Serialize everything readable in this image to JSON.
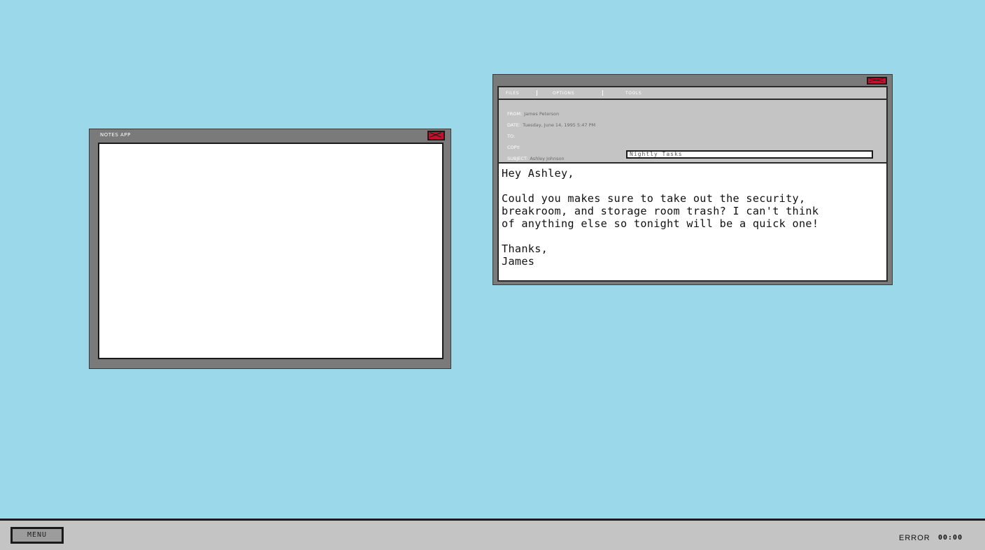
{
  "notes_app": {
    "title": "NOTES APP",
    "close_icon": "close-x-icon"
  },
  "email_app": {
    "close_icon": "close-x-icon",
    "menu": [
      {
        "label": "FILES"
      },
      {
        "label": "OPTIONS"
      },
      {
        "label": "TOOLS"
      }
    ],
    "from_label": "FROM:",
    "from_value": "James Peterson",
    "date_label": "DATE:",
    "date_value": "Tuesday, June 14, 1995 5:47 PM",
    "to_label": "TO:",
    "copy_label": "COPY:",
    "subject_label": "SUBJECT:",
    "subject_recipient": "Ashley Johnson",
    "subject_value": "Nightly Tasks",
    "body_lines": [
      "Hey Ashley,",
      "",
      "Could you makes sure to take out the security,",
      "breakroom, and storage room trash? I can't think",
      "of anything else so tonight will be a quick one!",
      "",
      "Thanks,",
      "James"
    ]
  },
  "taskbar": {
    "menu_label": "MENU",
    "status_label": "ERROR",
    "clock": "00:00"
  },
  "colors": {
    "desktop": "#9ad8ea",
    "window_frame": "#7a7a7a",
    "panel": "#c4c4c4",
    "close_button": "#c8102e"
  }
}
